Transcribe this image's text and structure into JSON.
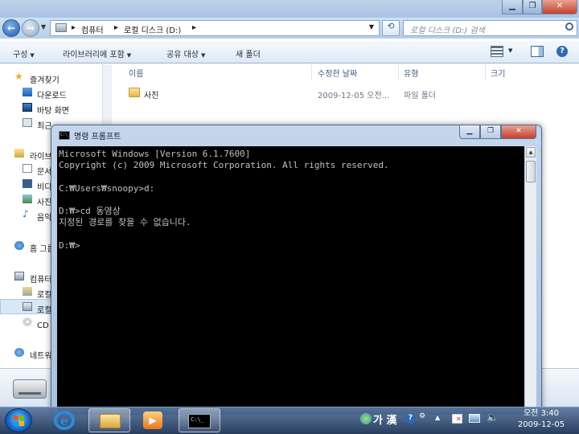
{
  "explorer": {
    "address": {
      "crumbs": [
        "컴퓨터",
        "로컬 디스크 (D:)"
      ]
    },
    "search_placeholder": "로컬 디스크 (D:) 검색",
    "toolbar": {
      "organize": "구성",
      "include_in_library": "라이브러리에 포함",
      "share_with": "공유 대상",
      "new_folder": "새 폴더"
    },
    "nav": {
      "favorites": "즐겨찾기",
      "downloads": "다운로드",
      "desktop": "바탕 화면",
      "recent": "최근 위치",
      "libraries": "라이브러리",
      "documents": "문서",
      "videos": "비디오",
      "pictures": "사진",
      "music": "음악",
      "homegroup": "홈 그룹",
      "computer": "컴퓨터",
      "local_c": "로컬 디스크 (C:)",
      "local_d": "로컬 디스크 (D:)",
      "cd_drive": "CD 드라이브",
      "network": "네트워크"
    },
    "columns": {
      "name": "이름",
      "modified": "수정한 날짜",
      "type": "유형",
      "size": "크기"
    },
    "files": [
      {
        "name": "사진",
        "modified": "2009-12-05 오전...",
        "type": "파일 폴더",
        "size": ""
      }
    ]
  },
  "cmd": {
    "title": "명령 프롬프트",
    "lines": [
      "Microsoft Windows [Version 6.1.7600]",
      "Copyright (c) 2009 Microsoft Corporation. All rights reserved.",
      "",
      "C:₩Users₩snoopy>d:",
      "",
      "D:₩>cd 동영상",
      "지정된 경로를 찾을 수 없습니다.",
      "",
      "D:₩>"
    ]
  },
  "taskbar": {
    "ime": "가 漢",
    "clock_period": "오전",
    "clock_time": "3:40",
    "clock_date": "2009-12-05"
  },
  "colors": {
    "console_bg": "#000000",
    "console_text": "#c0c0c0",
    "titlebar": "#b7cfe9"
  }
}
